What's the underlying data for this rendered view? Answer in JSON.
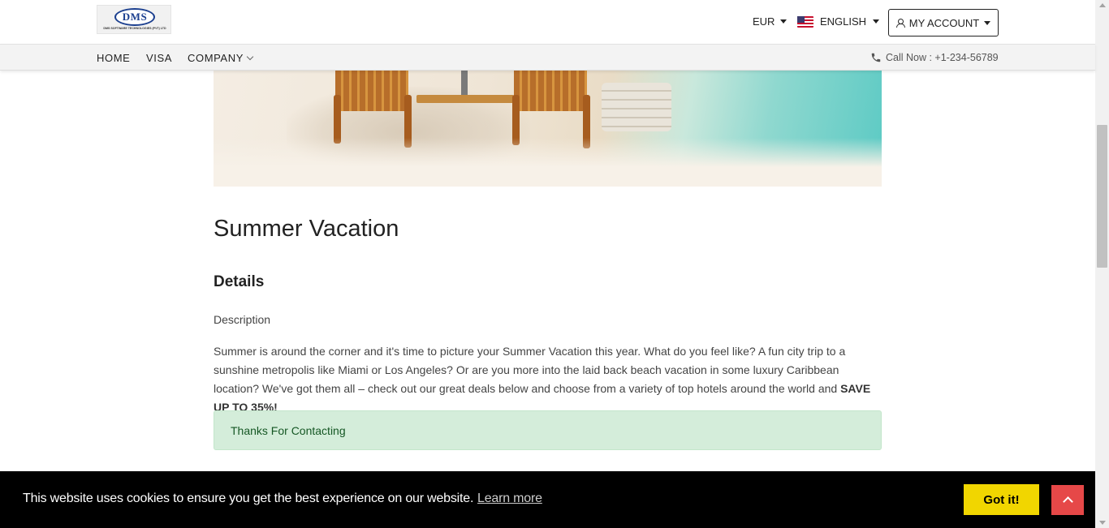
{
  "header": {
    "logo_text": "DMS",
    "logo_tagline": "DMS SOFTWARE TECHNOLOGIES (PVT) LTD",
    "currency": "EUR",
    "language": "ENGLISH",
    "account_label": "MY ACCOUNT"
  },
  "nav": {
    "items": [
      {
        "label": "HOME"
      },
      {
        "label": "VISA"
      },
      {
        "label": "COMPANY"
      }
    ],
    "call_text": "Call Now : +1-234-56789"
  },
  "content": {
    "title": "Summer Vacation",
    "subtitle": "Details",
    "description_label": "Description",
    "description": "Summer is around the corner and it's time to picture your Summer Vacation this year. What do you feel like? A fun city trip to a sunshine metropolis like Miami or Los Angeles? Or are you more into the laid back beach vacation in some luxury Caribbean location? We've got them all – check out our great deals below and choose from a variety of top hotels around the world and ",
    "description_bold": "SAVE UP TO 35%!",
    "alert_text": "Thanks For Contacting"
  },
  "cookie": {
    "message": "This website uses cookies to ensure you get the best experience on our website.",
    "learn_more": "Learn more",
    "accept": "Got it!"
  },
  "icons": {
    "flag": "us-flag-icon",
    "account": "user-icon",
    "phone": "phone-icon",
    "back_to_top": "chevron-up-icon"
  },
  "colors": {
    "alert_bg": "#d4edda",
    "alert_text": "#155724",
    "cookie_bg": "#000000",
    "accept_button": "#f1d600",
    "back_to_top": "#e64848"
  }
}
